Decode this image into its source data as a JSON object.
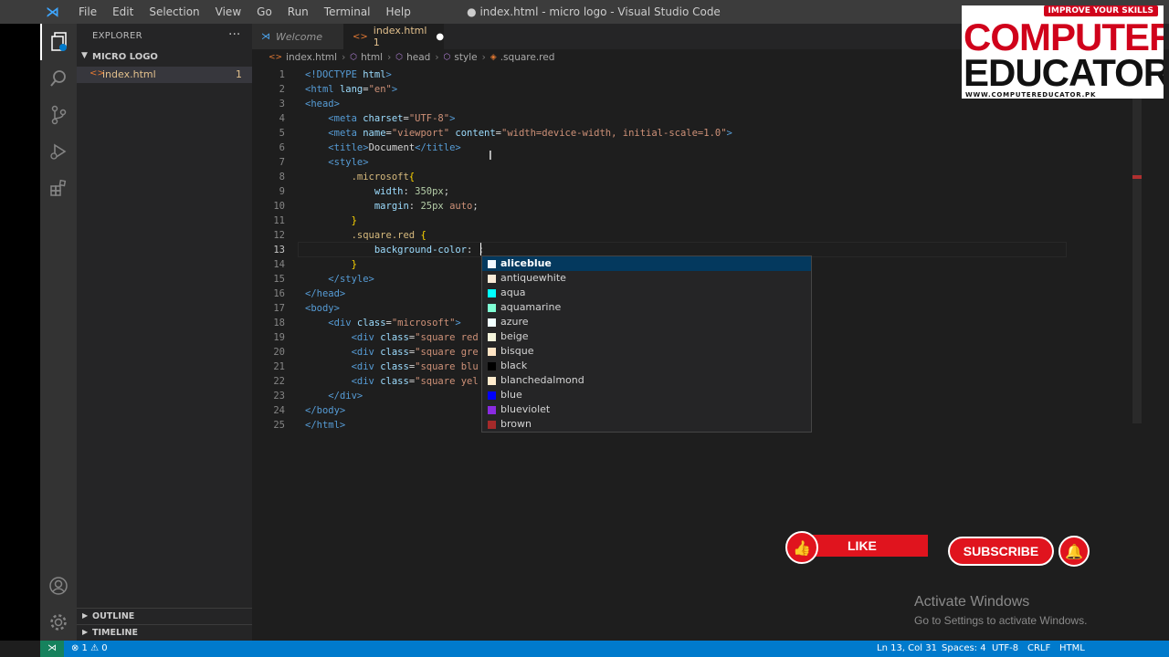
{
  "window": {
    "title": "● index.html - micro logo - Visual Studio Code",
    "menu": [
      "File",
      "Edit",
      "Selection",
      "View",
      "Go",
      "Run",
      "Terminal",
      "Help"
    ]
  },
  "activity_bar": [
    "explorer-icon",
    "search-icon",
    "source-control-icon",
    "run-debug-icon",
    "extensions-icon",
    "account-icon",
    "settings-gear-icon"
  ],
  "sidebar": {
    "title": "EXPLORER",
    "more": "···",
    "folder": "MICRO LOGO",
    "file": {
      "name": "index.html",
      "problems": "1"
    },
    "outline": "OUTLINE",
    "timeline": "TIMELINE"
  },
  "tabs": [
    {
      "label": "Welcome"
    },
    {
      "label": "index.html 1"
    }
  ],
  "breadcrumb": [
    "index.html",
    "html",
    "head",
    "style",
    ".square.red"
  ],
  "editor": {
    "line_numbers": [
      "1",
      "2",
      "3",
      "4",
      "5",
      "6",
      "7",
      "8",
      "9",
      "10",
      "11",
      "12",
      "13",
      "14",
      "15",
      "16",
      "17",
      "18",
      "19",
      "20",
      "21",
      "22",
      "23",
      "24",
      "25"
    ],
    "current_line": 13
  },
  "suggestions": [
    {
      "label": "aliceblue",
      "color": "#f0f8ff"
    },
    {
      "label": "antiquewhite",
      "color": "#faebd7"
    },
    {
      "label": "aqua",
      "color": "#00ffff"
    },
    {
      "label": "aquamarine",
      "color": "#7fffd4"
    },
    {
      "label": "azure",
      "color": "#f0ffff"
    },
    {
      "label": "beige",
      "color": "#f5f5dc"
    },
    {
      "label": "bisque",
      "color": "#ffe4c4"
    },
    {
      "label": "black",
      "color": "#000000"
    },
    {
      "label": "blanchedalmond",
      "color": "#ffebcd"
    },
    {
      "label": "blue",
      "color": "#0000ff"
    },
    {
      "label": "blueviolet",
      "color": "#8a2be2"
    },
    {
      "label": "brown",
      "color": "#a52a2a"
    }
  ],
  "statusbar": {
    "problems": "⊗ 1 ⚠ 0",
    "position": "Ln 13, Col 31",
    "spaces": "Spaces: 4",
    "encoding": "UTF-8",
    "eol": "CRLF",
    "language": "HTML"
  },
  "overlay": {
    "brand_top": "IMPROVE YOUR SKILLS",
    "brand_line1": "COMPUTER",
    "brand_line2": "EDUCATOR",
    "brand_url": "WWW.COMPUTEREDUCATOR.PK",
    "like": "LIKE",
    "subscribe": "SUBSCRIBE",
    "activate_title": "Activate Windows",
    "activate_sub": "Go to Settings to activate Windows."
  },
  "colors": {
    "editor_bg": "#1e1e1e",
    "statusbar": "#007acc",
    "accent_red": "#e0141e"
  }
}
